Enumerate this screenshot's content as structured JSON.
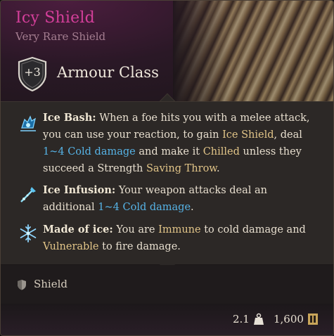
{
  "item": {
    "name": "Icy Shield",
    "rarity": "Very Rare Shield",
    "armour_class_value": "+3",
    "armour_class_label": "Armour Class"
  },
  "entries": [
    {
      "icon": "ice-bash-icon",
      "parts": [
        "Ice Bash:",
        " When a foe hits you with a melee attack, you can use your reaction, to gain ",
        "Ice Shield",
        ", deal ",
        "1~4 Cold damage",
        " and make it ",
        "Chilled",
        " unless they succeed a Strength ",
        "Saving Throw",
        "."
      ]
    },
    {
      "icon": "ice-infusion-icon",
      "parts": [
        "Ice Infusion:",
        " Your weapon attacks deal an additional ",
        "1~4 Cold damage",
        "."
      ]
    },
    {
      "icon": "snowflake-icon",
      "parts": [
        "Made of ice:",
        " You are ",
        "Immune",
        " to cold damage and ",
        "Vulnerable",
        " to fire damage."
      ]
    }
  ],
  "footer": {
    "type_icon": "shield-icon",
    "type_label": "Shield",
    "weight": "2.1",
    "weight_icon": "weight-icon",
    "price": "1,600",
    "price_icon": "gold-icon"
  },
  "colors": {
    "name": "#d43f9a",
    "rarity": "#a47d90",
    "keyword_gold": "#e2c588",
    "keyword_blue": "#56b3e6"
  }
}
